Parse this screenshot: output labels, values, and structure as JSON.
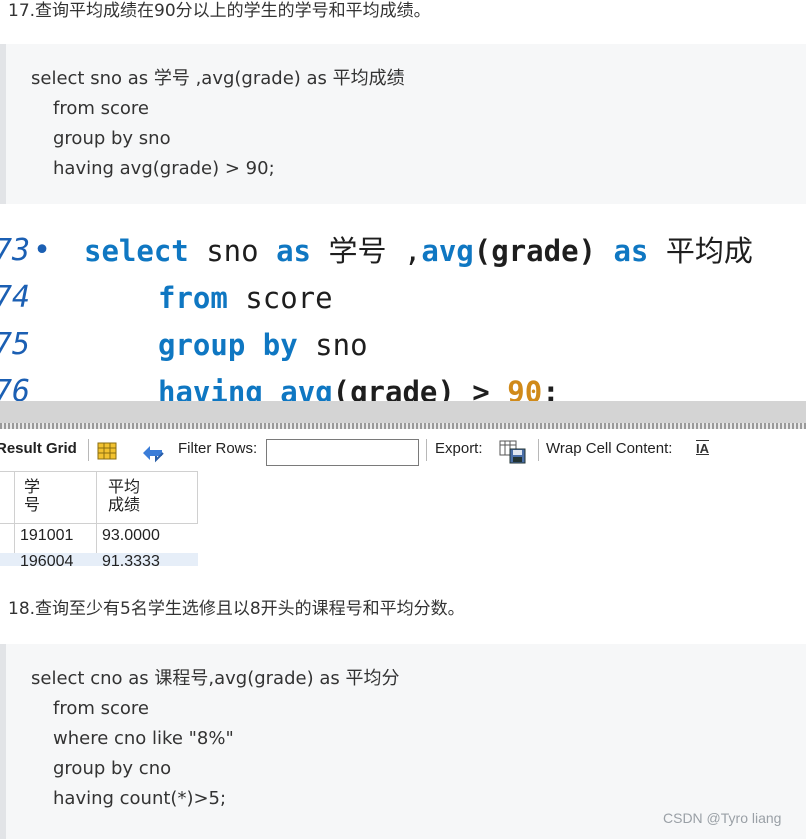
{
  "q17": {
    "title": "17.查询平均成绩在90分以上的学生的学号和平均成绩。"
  },
  "sql17": {
    "lines": [
      "select sno as 学号 ,avg(grade) as 平均成绩",
      "from score",
      "group by sno",
      "having avg(grade) > 90;"
    ]
  },
  "editor": {
    "line_numbers": [
      "73",
      "74",
      "75",
      "76"
    ],
    "line1": {
      "kw1": "select",
      "t1": " sno ",
      "kw2": "as",
      "t2": " 学号 ,",
      "kw3": "avg",
      "t3": "(grade) ",
      "kw4": "as",
      "t4": " 平均成"
    },
    "line2": {
      "kw": "from",
      "t": " score"
    },
    "line3": {
      "kw1": "group",
      "kw2": "by",
      "t": " sno"
    },
    "line4": {
      "kw1": "having",
      "kw2": "avg",
      "t": "(grade) > ",
      "num": "90",
      "end": ";"
    }
  },
  "result_toolbar": {
    "result_grid": "Result Grid",
    "filter_rows": "Filter Rows:",
    "filter_value": "",
    "export": "Export:",
    "wrap": "Wrap Cell Content:",
    "wrap_icon": "IA"
  },
  "result_grid": {
    "headers": [
      [
        "学",
        "号"
      ],
      [
        "平均",
        "成绩"
      ]
    ],
    "rows": [
      [
        "191001",
        "93.0000"
      ],
      [
        "196004",
        "91.3333"
      ]
    ]
  },
  "q18": {
    "title": "18.查询至少有5名学生选修且以8开头的课程号和平均分数。"
  },
  "sql18": {
    "lines": [
      "select cno as 课程号,avg(grade) as 平均分",
      "from score",
      "where cno like \"8%\"",
      "group by cno",
      "having count(*)>5;"
    ]
  },
  "watermark": "CSDN @Tyro liang"
}
